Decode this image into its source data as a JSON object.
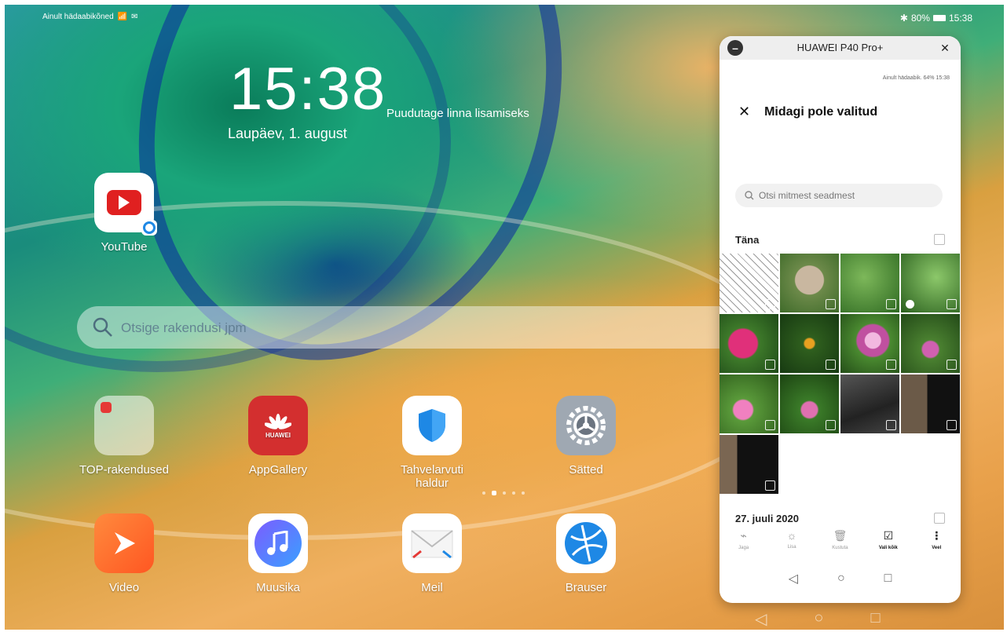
{
  "statusbar": {
    "left_text": "Ainult hädaabikõned",
    "battery": "80%",
    "time": "15:38"
  },
  "lockinfo": {
    "clock": "15:38",
    "date": "Laupäev, 1. august",
    "hint": "Puudutage linna lisamiseks"
  },
  "search": {
    "placeholder": "Otsige rakendusi jpm"
  },
  "apps_top": [
    {
      "label": "YouTube",
      "icon": "youtube-icon"
    }
  ],
  "apps_row1": [
    {
      "label": "TOP-rakendused",
      "icon": "folder-icon"
    },
    {
      "label": "AppGallery",
      "icon": "huawei-icon",
      "sub": "HUAWEI"
    },
    {
      "label": "Tahvelarvuti haldur",
      "icon": "shield-icon"
    },
    {
      "label": "Sätted",
      "icon": "gear-icon"
    }
  ],
  "apps_row2": [
    {
      "label": "Video",
      "icon": "play-icon"
    },
    {
      "label": "Muusika",
      "icon": "music-icon"
    },
    {
      "label": "Meil",
      "icon": "mail-icon"
    },
    {
      "label": "Brauser",
      "icon": "browser-icon"
    }
  ],
  "phone": {
    "title": "HUAWEI P40 Pro+",
    "statusbar": "Ainult hädaabik. 64% 15:38",
    "header": "Midagi pole valitud",
    "search_placeholder": "Otsi mitmest seadmest",
    "section_today": "Täna",
    "section_past": "27. juuli 2020",
    "toolbar": [
      {
        "label": "Jaga",
        "icon": "share-icon",
        "active": false
      },
      {
        "label": "Lisa",
        "icon": "bulb-icon",
        "active": false
      },
      {
        "label": "Kustuta",
        "icon": "trash-icon",
        "active": false
      },
      {
        "label": "Vali kõik",
        "icon": "select-all-icon",
        "active": true
      },
      {
        "label": "Veel",
        "icon": "more-icon",
        "active": true
      }
    ]
  },
  "colors": {
    "accent": "#e02020",
    "shield": "#1e88e5"
  }
}
